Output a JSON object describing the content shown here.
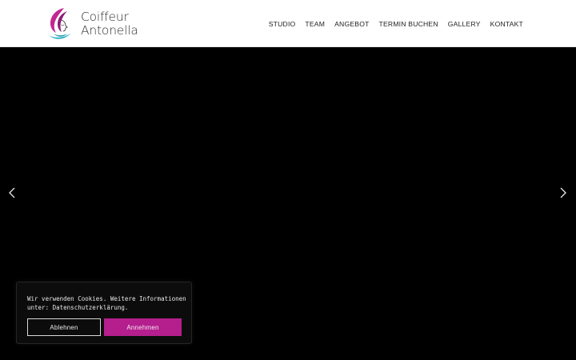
{
  "header": {
    "logo": {
      "line1": "Coiffeur",
      "line2": "Antonella"
    },
    "nav": [
      {
        "label": "STUDIO"
      },
      {
        "label": "TEAM"
      },
      {
        "label": "ANGEBOT"
      },
      {
        "label": "TERMIN BUCHEN"
      },
      {
        "label": "GALLERY"
      },
      {
        "label": "KONTAKT"
      }
    ]
  },
  "hero": {
    "prev_icon": "chevron-left-icon",
    "next_icon": "chevron-right-icon"
  },
  "cookie_banner": {
    "text": "Wir verwenden Cookies. Weitere Informationen unter: ",
    "link": "Datenschutzerklärung",
    "link_suffix": ".",
    "decline_label": "Ablehnen",
    "accept_label": "Annehmen"
  },
  "colors": {
    "accent": "#b41f8d",
    "logo_magenta": "#c2268f",
    "logo_teal": "#2bb3c8",
    "hero_background": "#000000",
    "header_background": "#ffffff"
  }
}
